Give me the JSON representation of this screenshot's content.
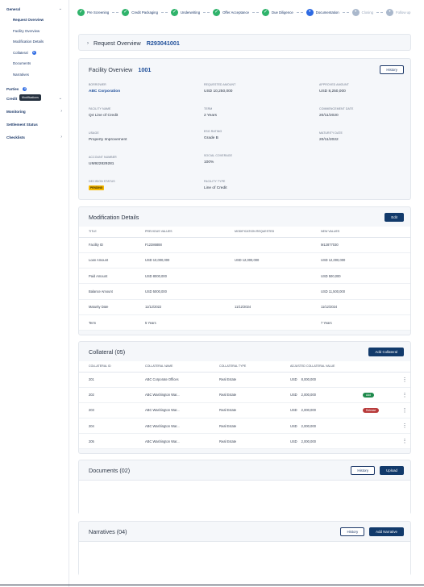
{
  "sidebar": {
    "groups": [
      {
        "label": "General",
        "chev": "⌄"
      },
      {
        "label": "Parties",
        "chev": ""
      },
      {
        "label": "Credit",
        "chev": "⌄"
      },
      {
        "label": "Monitoring",
        "chev": "›"
      },
      {
        "label": "Settlement Status",
        "chev": ""
      },
      {
        "label": "Checklists",
        "chev": "›"
      }
    ],
    "general_items": [
      {
        "label": "Request Overview"
      },
      {
        "label": "Facility Overview"
      },
      {
        "label": "Modification Details"
      },
      {
        "label": "Collateral",
        "badge": "6"
      },
      {
        "label": "Documents"
      },
      {
        "label": "Narratives"
      }
    ],
    "parties_badge": "3",
    "tooltip": "Modifications"
  },
  "stepper": [
    {
      "label": "Pre Screening",
      "state": "done"
    },
    {
      "label": "Credit Packaging",
      "state": "done"
    },
    {
      "label": "Underwriting",
      "state": "done"
    },
    {
      "label": "Offer Acceptance",
      "state": "done"
    },
    {
      "label": "Due Diligence",
      "state": "done"
    },
    {
      "label": "Documentation",
      "state": "current"
    },
    {
      "label": "Closing",
      "state": "pending"
    },
    {
      "label": "Follow up",
      "state": "pending"
    }
  ],
  "request": {
    "title": "Request Overview",
    "id": "R293041001"
  },
  "facility": {
    "title": "Facility Overview",
    "id": "1001",
    "history_label": "History",
    "fields": {
      "borrower": {
        "label": "Borrower",
        "value": "ABC Corporation"
      },
      "requested_amount": {
        "label": "Requested Amount",
        "value": "USD 10,250,000"
      },
      "approved_amount": {
        "label": "Approved Amount",
        "value": "USD 8,250,000"
      },
      "facility_name": {
        "label": "Facility Name",
        "value": "Q4 Line of Credit"
      },
      "term": {
        "label": "Term",
        "value": "2 Years"
      },
      "commencement_date": {
        "label": "Commencement Date",
        "value": "20/11/2020"
      },
      "usage": {
        "label": "Usage",
        "value": "Property Improvement"
      },
      "esg_rating": {
        "label": "ESG Rating",
        "value": "Grade B"
      },
      "maturity_date": {
        "label": "Maturity Date",
        "value": "20/11/2022"
      },
      "account_number": {
        "label": "Account Number",
        "value": "UM922829281"
      },
      "social_coverage": {
        "label": "Social Coverage",
        "value": "100%"
      },
      "decision_status": {
        "label": "Decision Status",
        "value": "PENDING"
      },
      "facility_type": {
        "label": "Facility Type",
        "value": "Line of Credit"
      }
    }
  },
  "modification": {
    "title": "Modification Details",
    "edit_label": "Edit",
    "headers": [
      "Title",
      "Previous Values",
      "Modification Requested",
      "New Values"
    ],
    "rows": [
      [
        "Facility ID",
        "F12386888",
        "",
        "M12877030"
      ],
      [
        "Loan Amount",
        "USD 10,000,000",
        "USD 12,000,000",
        "USD 12,000,000"
      ],
      [
        "Paid Amount",
        "USD 8000,000",
        "",
        "USD 500,000"
      ],
      [
        "Balance Amount",
        "USD 5000,000",
        "",
        "USD 11,500,000"
      ],
      [
        "Maturity Date",
        "11/12/2022",
        "11/12/2024",
        "11/12/2024"
      ],
      [
        "Term",
        "5 Years",
        "",
        "7 Years"
      ]
    ]
  },
  "collateral": {
    "title": "Collateral (05)",
    "add_label": "Add Collateral",
    "headers": [
      "Collateral ID",
      "Collateral Name",
      "Collateral Type",
      "Adjusted Collateral Value"
    ],
    "rows": [
      {
        "id": "201",
        "name": "ABC Corporate Offices",
        "type": "Real Estate",
        "currency": "USD",
        "value": "8,000,000",
        "tag": ""
      },
      {
        "id": "202",
        "name": "ABC Washington War...",
        "type": "Real Estate",
        "currency": "USD",
        "value": "2,000,000",
        "tag": "Add"
      },
      {
        "id": "203",
        "name": "ABC Washington War...",
        "type": "Real Estate",
        "currency": "USD",
        "value": "2,000,000",
        "tag": "Release"
      },
      {
        "id": "204",
        "name": "ABC Washington War...",
        "type": "Real Estate",
        "currency": "USD",
        "value": "2,000,000",
        "tag": ""
      },
      {
        "id": "205",
        "name": "ABC Washington War...",
        "type": "Real Estate",
        "currency": "USD",
        "value": "2,000,000",
        "tag": ""
      }
    ]
  },
  "documents": {
    "title": "Documents (02)",
    "history_label": "History",
    "upload_label": "Upload"
  },
  "narratives": {
    "title": "Narratives (04)",
    "history_label": "History",
    "add_label": "Add Narrative"
  },
  "colors": {
    "primary": "#123a6b",
    "done": "#2fb36b",
    "current": "#2d6ae3",
    "pending": "#f5b800"
  }
}
